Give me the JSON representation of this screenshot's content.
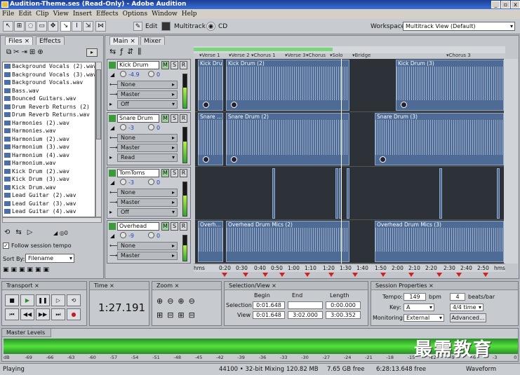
{
  "window": {
    "title": "Audition-Theme.ses (Read-Only) - Adobe Audition",
    "min": "_",
    "max": "▫",
    "close": "x"
  },
  "menu": [
    "File",
    "Edit",
    "Clip",
    "View",
    "Insert",
    "Effects",
    "Options",
    "Window",
    "Help"
  ],
  "toolbar": {
    "edit": "Edit",
    "multitrack": "Multitrack",
    "cd": "CD",
    "workspace_label": "Workspace:",
    "workspace_value": "Multitrack View (Default)"
  },
  "left": {
    "tab_files": "Files",
    "tab_effects": "Effects",
    "files": [
      "Background Vocals (2).wav",
      "Background Vocals (3).wav",
      "Background Vocals.wav",
      "Bass.wav",
      "Bounced Guitars.wav",
      "Drum Reverb Returns (2)",
      "Drum Reverb Returns.wav",
      "Harmonies (2).wav",
      "Harmonies.wav",
      "Harmonium (2).wav",
      "Harmonium (3).wav",
      "Harmonium (4).wav",
      "Harmonium.wav",
      "Kick Drum (2).wav",
      "Kick Drum (3).wav",
      "Kick Drum.wav",
      "Lead Guitar (2).wav",
      "Lead Guitar (3).wav",
      "Lead Guitar (4).wav"
    ],
    "follow_tempo": "Follow session tempo",
    "sort_by_label": "Sort By:",
    "sort_by_value": "Filename"
  },
  "main": {
    "tab_main": "Main",
    "tab_mixer": "Mixer"
  },
  "tracks": [
    {
      "name": "Kick Drum",
      "vol": "-4.9",
      "pan": "0",
      "out": "None",
      "bus": "Master",
      "mode": "Off"
    },
    {
      "name": "Snare Drum",
      "vol": "-3",
      "pan": "0",
      "out": "None",
      "bus": "Master",
      "mode": "Read"
    },
    {
      "name": "TomToms",
      "vol": "-3",
      "pan": "0",
      "out": "None",
      "bus": "Master",
      "mode": "Off"
    },
    {
      "name": "Overhead",
      "vol": "-9",
      "pan": "0",
      "out": "None",
      "bus": "Master",
      "mode": ""
    }
  ],
  "msr": {
    "m": "M",
    "s": "S",
    "r": "R"
  },
  "markers": [
    "Verse 1",
    "Verse 2",
    "Chorus 1",
    "Verse 3",
    "Chorus",
    "Solo",
    "Bridge",
    "Chorus 3"
  ],
  "clips": {
    "kick": [
      "Kick Drum",
      "Kick Drum (2)",
      "Kick Drum (3)"
    ],
    "snare": [
      "Snare ...",
      "Snare Drum (2)",
      "Snare Drum (3)"
    ],
    "overhead": [
      "Overh...",
      "Overhead Drum Mics (2)",
      "Overhead Drum Mics (3)"
    ]
  },
  "ruler": [
    "hms",
    "0:20",
    "0:30",
    "0:40",
    "0:50",
    "1:00",
    "1:10",
    "1:20",
    "1:30",
    "1:40",
    "1:50",
    "2:00",
    "2:10",
    "2:20",
    "2:30",
    "2:40",
    "2:50",
    "hms"
  ],
  "transport": {
    "title": "Transport"
  },
  "time": {
    "title": "Time",
    "value": "1:27.191"
  },
  "zoom": {
    "title": "Zoom"
  },
  "selection": {
    "title": "Selection/View",
    "begin": "Begin",
    "end": "End",
    "length": "Length",
    "sel_label": "Selection",
    "view_label": "View",
    "sel_begin": "0:01.648",
    "sel_end": "",
    "sel_length": "0:00.000",
    "view_begin": "0:01.648",
    "view_end": "3:02.000",
    "view_length": "3:00.352"
  },
  "session": {
    "title": "Session Properties",
    "tempo_label": "Tempo:",
    "tempo": "149",
    "bpm": "bpm",
    "beats": "4",
    "beats_label": "beats/bar",
    "key_label": "Key:",
    "key": "A",
    "time_sig": "4/4 time",
    "monitoring_label": "Monitoring:",
    "monitoring": "External",
    "advanced": "Advanced..."
  },
  "master": {
    "title": "Master Levels",
    "scale": [
      "dB",
      "-69",
      "-66",
      "-63",
      "-60",
      "-57",
      "-54",
      "-51",
      "-48",
      "-45",
      "-42",
      "-39",
      "-36",
      "-33",
      "-30",
      "-27",
      "-24",
      "-21",
      "-18",
      "-15",
      "-12",
      "-9",
      "-6",
      "-3",
      "0"
    ]
  },
  "status": {
    "state": "Playing",
    "rate": "44100 • 32-bit Mixing",
    "mem": "120.82 MB",
    "free": "7.65 GB free",
    "time_free": "6:28:13.648 free",
    "view": "Waveform"
  },
  "watermark": "最需教育"
}
